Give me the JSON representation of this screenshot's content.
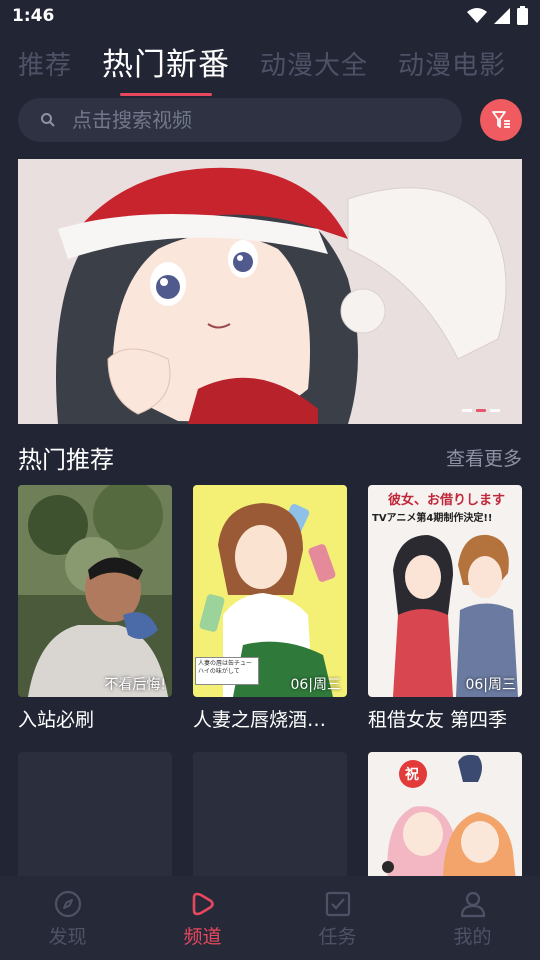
{
  "status_bar": {
    "time": "1:46"
  },
  "tabs": [
    {
      "label": "推荐",
      "active": false
    },
    {
      "label": "热门新番",
      "active": true
    },
    {
      "label": "动漫大全",
      "active": false
    },
    {
      "label": "动漫电影",
      "active": false
    }
  ],
  "search": {
    "placeholder": "点击搜索视频"
  },
  "banner": {
    "slide_count": 3,
    "active_index": 1
  },
  "section": {
    "title": "热门推荐",
    "more": "查看更多"
  },
  "cards": [
    {
      "title": "入站必刷",
      "badge": "不看后悔!"
    },
    {
      "title": "人妻之唇烧酒…",
      "badge": "06|周三"
    },
    {
      "title": "租借女友 第四季",
      "badge": "06|周三"
    },
    {
      "title": "",
      "badge": ""
    },
    {
      "title": "",
      "badge": ""
    },
    {
      "title": "",
      "badge": ""
    }
  ],
  "cover_texts": {
    "card2_small": "人妻の唇は缶チューハイの味がして",
    "card3_top": "彼女、お借りします",
    "card3_sub": "TVアニメ第4期制作決定!!",
    "card6_stamp": "祝"
  },
  "bottom_nav": [
    {
      "label": "发现",
      "icon": "compass-icon",
      "active": false
    },
    {
      "label": "频道",
      "icon": "play-icon",
      "active": true
    },
    {
      "label": "任务",
      "icon": "checkbox-icon",
      "active": false
    },
    {
      "label": "我的",
      "icon": "user-icon",
      "active": false
    }
  ],
  "colors": {
    "background": "#222533",
    "accent": "#e8485e",
    "filter": "#ef5b60",
    "inactive": "#4d5266"
  }
}
